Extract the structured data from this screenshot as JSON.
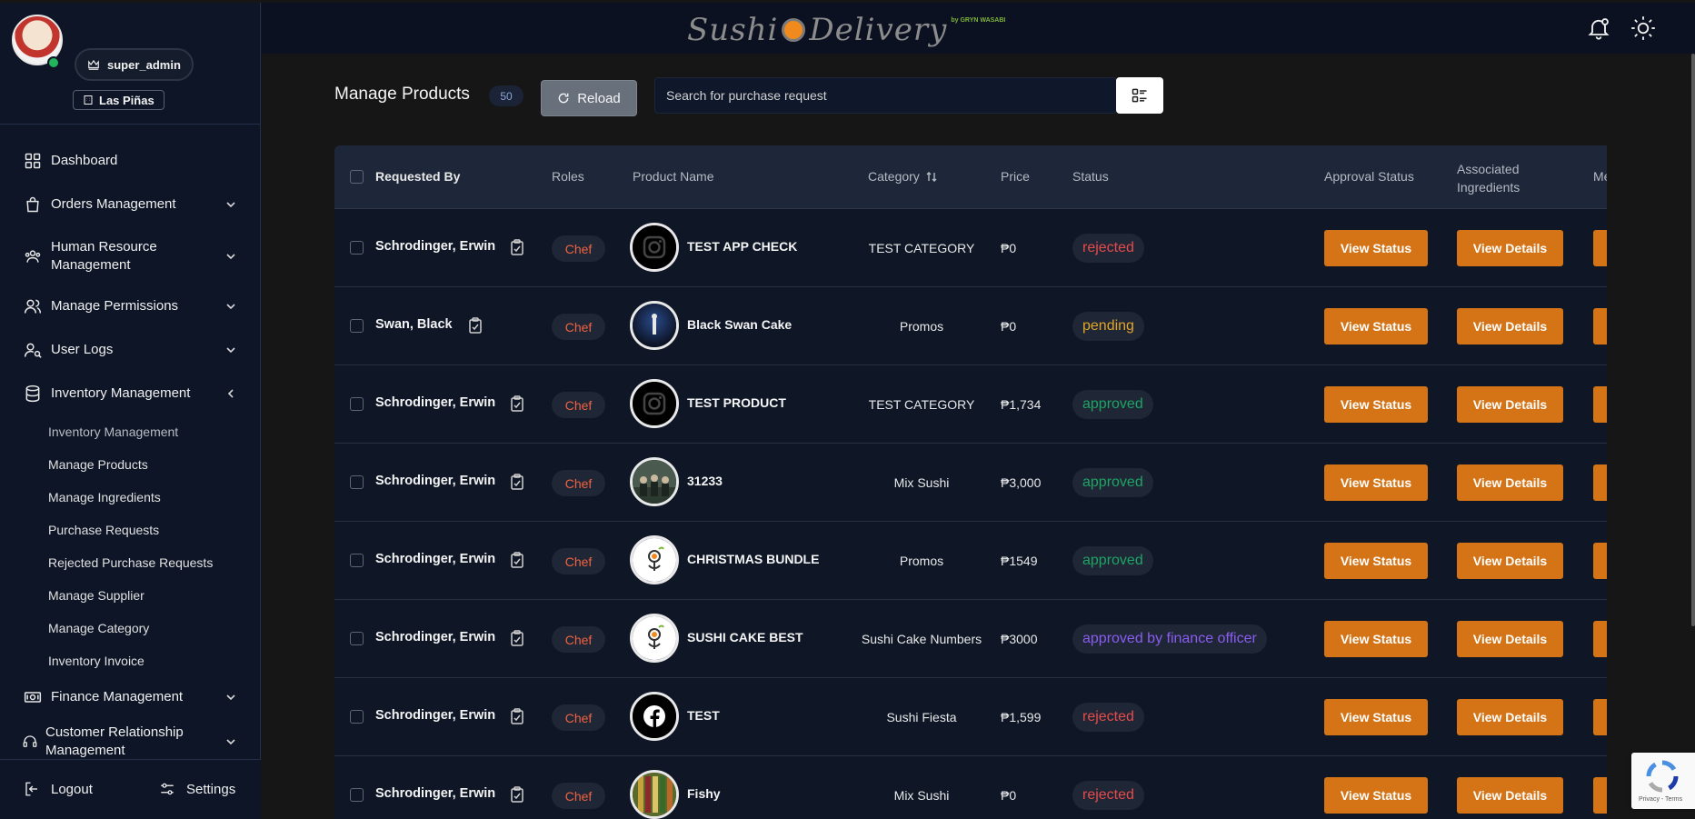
{
  "sidebar": {
    "user_role": "super_admin",
    "branch": "Las Piñas",
    "nav": [
      {
        "label": "Dashboard",
        "icon": "grid-icon",
        "chevron": ""
      },
      {
        "label": "Orders Management",
        "icon": "shopping-bag-icon",
        "chevron": "down"
      },
      {
        "label": "Human Resource Management",
        "icon": "users-gear-icon",
        "chevron": "down"
      },
      {
        "label": "Manage Permissions",
        "icon": "users-icon",
        "chevron": "down"
      },
      {
        "label": "User Logs",
        "icon": "user-search-icon",
        "chevron": "down"
      },
      {
        "label": "Inventory Management",
        "icon": "database-icon",
        "chevron": "left"
      },
      {
        "label": "Finance Management",
        "icon": "money-icon",
        "chevron": "down"
      },
      {
        "label": "Customer Relationship Management",
        "icon": "headset-icon",
        "chevron": "down"
      }
    ],
    "inventory_sub": [
      "Inventory Management",
      "Manage Products",
      "Manage Ingredients",
      "Purchase Requests",
      "Rejected Purchase Requests",
      "Manage Supplier",
      "Manage Category",
      "Inventory Invoice"
    ],
    "footer": {
      "logout": "Logout",
      "settings": "Settings"
    }
  },
  "topbar": {
    "logo_text_left": "Sushi",
    "logo_text_right": "Delivery",
    "logo_tag": "by GRYN WASABI"
  },
  "header": {
    "title": "Manage Products",
    "count": "50",
    "reload": "Reload",
    "search_placeholder": "Search for purchase request"
  },
  "table": {
    "columns": {
      "requested_by": "Requested By",
      "roles": "Roles",
      "product_name": "Product Name",
      "category": "Category",
      "price": "Price",
      "status": "Status",
      "approval_status": "Approval Status",
      "associated_ingredients_1": "Associated",
      "associated_ingredients_2": "Ingredients",
      "more": "Me"
    },
    "buttons": {
      "view_status": "View Status",
      "view_details": "View Details"
    },
    "rows": [
      {
        "requested_by": "Schrodinger, Erwin",
        "role": "Chef",
        "product": "TEST APP CHECK",
        "category": "TEST CATEGORY",
        "price": "₱0",
        "status": "rejected",
        "status_kind": "rejected",
        "thumb": "instagram"
      },
      {
        "requested_by": "Swan, Black",
        "role": "Chef",
        "product": "Black Swan Cake",
        "category": "Promos",
        "price": "₱0",
        "status": "pending",
        "status_kind": "pending",
        "thumb": "dark-stage"
      },
      {
        "requested_by": "Schrodinger, Erwin",
        "role": "Chef",
        "product": "TEST PRODUCT",
        "category": "TEST CATEGORY",
        "price": "₱1,734",
        "status": "approved",
        "status_kind": "approved",
        "thumb": "instagram"
      },
      {
        "requested_by": "Schrodinger, Erwin",
        "role": "Chef",
        "product": "31233",
        "category": "Mix Sushi",
        "price": "₱3,000",
        "status": "approved",
        "status_kind": "approved",
        "thumb": "group-photo"
      },
      {
        "requested_by": "Schrodinger, Erwin",
        "role": "Chef",
        "product": "CHRISTMAS BUNDLE",
        "category": "Promos",
        "price": "₱1549",
        "status": "approved",
        "status_kind": "approved",
        "thumb": "brand-logo"
      },
      {
        "requested_by": "Schrodinger, Erwin",
        "role": "Chef",
        "product": "SUSHI CAKE BEST",
        "category": "Sushi Cake Numbers",
        "price": "₱3000",
        "status": "approved by finance officer",
        "status_kind": "finance",
        "thumb": "brand-logo"
      },
      {
        "requested_by": "Schrodinger, Erwin",
        "role": "Chef",
        "product": "TEST",
        "category": "Sushi Fiesta",
        "price": "₱1,599",
        "status": "rejected",
        "status_kind": "rejected",
        "thumb": "facebook"
      },
      {
        "requested_by": "Schrodinger, Erwin",
        "role": "Chef",
        "product": "Fishy",
        "category": "Mix Sushi",
        "price": "₱0",
        "status": "rejected",
        "status_kind": "rejected",
        "thumb": "food-photo"
      }
    ]
  },
  "recaptcha": {
    "terms": "Privacy - Terms"
  }
}
